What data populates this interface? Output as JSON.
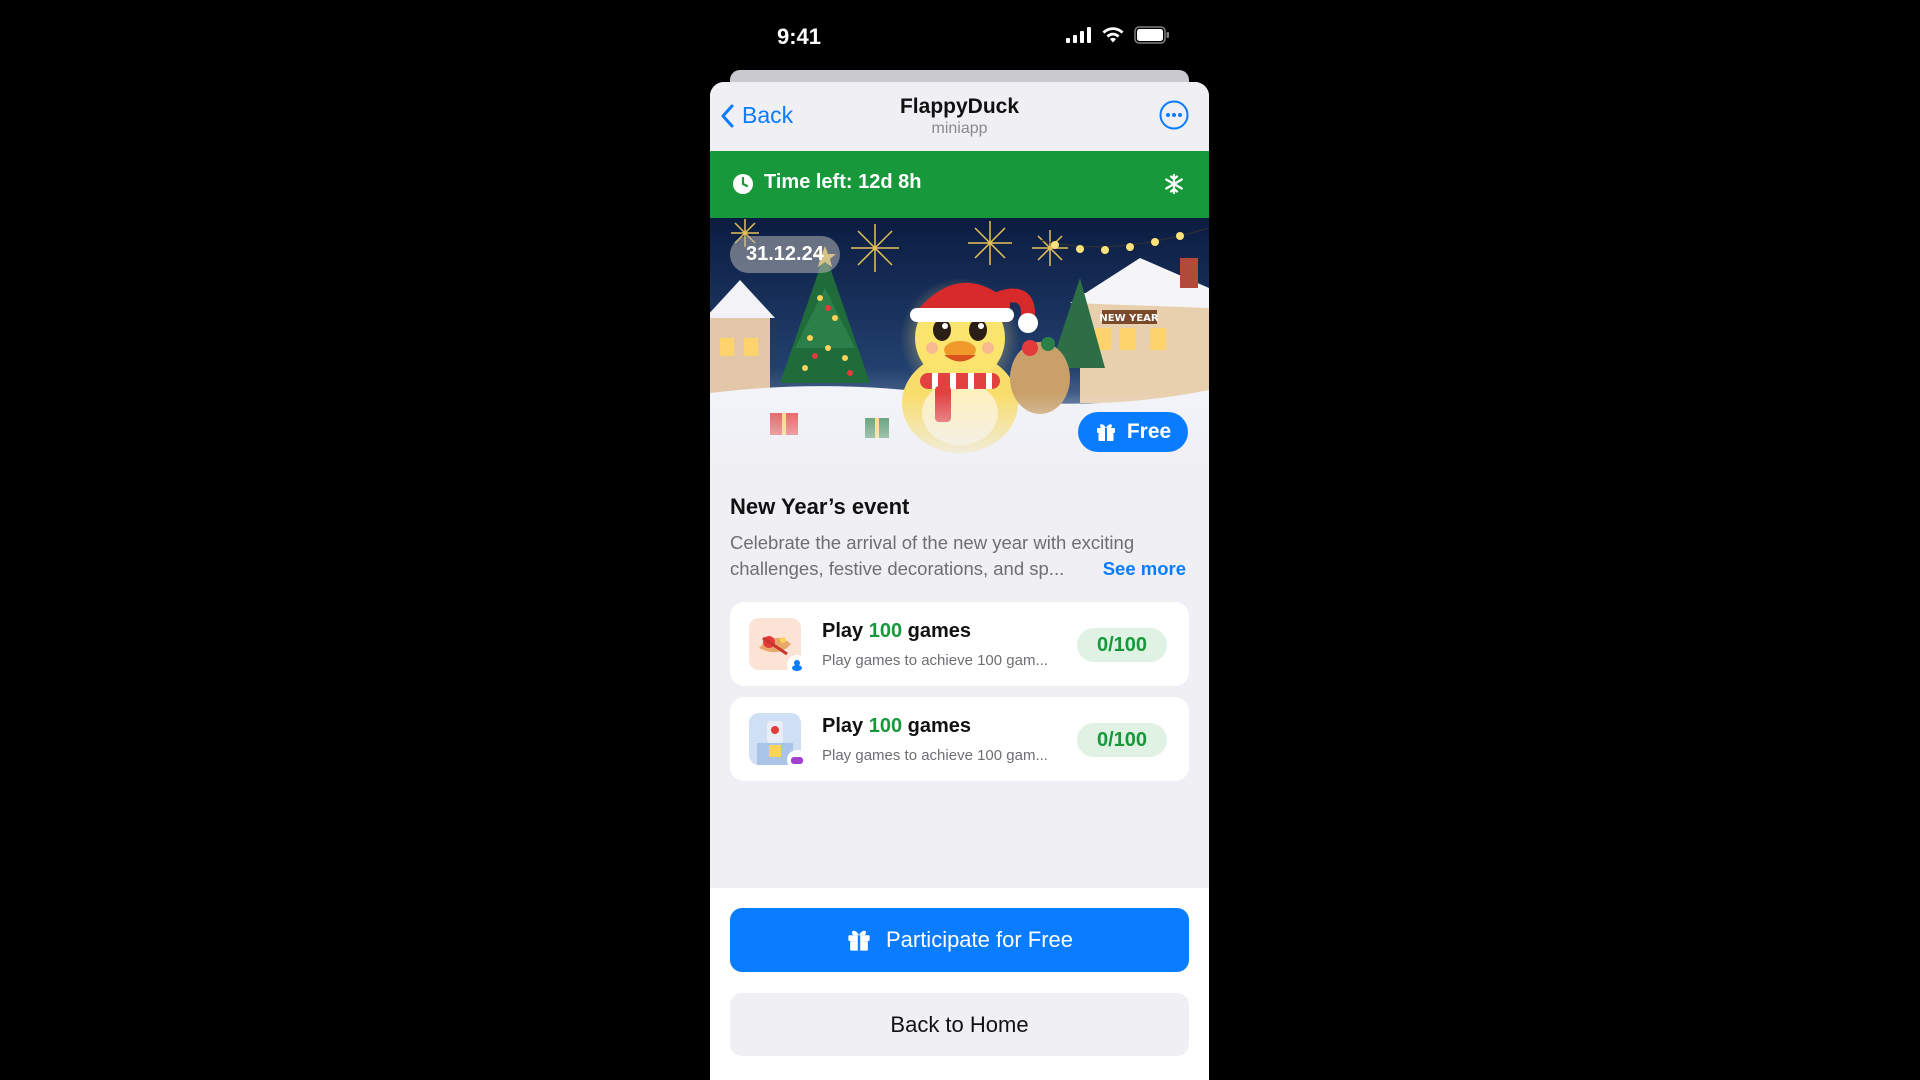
{
  "status_bar": {
    "time": "9:41",
    "icons": [
      "cellular-signal-icon",
      "wifi-icon",
      "battery-icon"
    ]
  },
  "nav": {
    "back_label": "Back",
    "title": "FlappyDuck",
    "subtitle": "miniapp",
    "more_icon": "more-horizontal-icon"
  },
  "timer": {
    "text": "Time left: 12d 8h",
    "icon": "clock-icon",
    "right_icon": "snowflake-icon"
  },
  "hero": {
    "date": "31.12.24",
    "badge_label": "Free",
    "badge_icon": "gift-icon"
  },
  "event": {
    "title": "New Year’s event",
    "description_line1": "Celebrate the arrival of the new year with exciting",
    "description_line2": "challenges, festive decorations, and sp...",
    "see_more": "See more"
  },
  "tasks": [
    {
      "prefix": "Play ",
      "highlight": "100",
      "suffix": " games",
      "subtitle": "Play games to achieve 100 gam...",
      "progress": "0/100"
    },
    {
      "prefix": "Play ",
      "highlight": "100",
      "suffix": " games",
      "subtitle": "Play games to achieve 100 gam...",
      "progress": "0/100"
    }
  ],
  "buttons": {
    "participate": "Participate for Free",
    "back_home": "Back to Home"
  },
  "colors": {
    "accent": "#0a7cff",
    "green": "#17993b",
    "background": "#efeff4"
  }
}
